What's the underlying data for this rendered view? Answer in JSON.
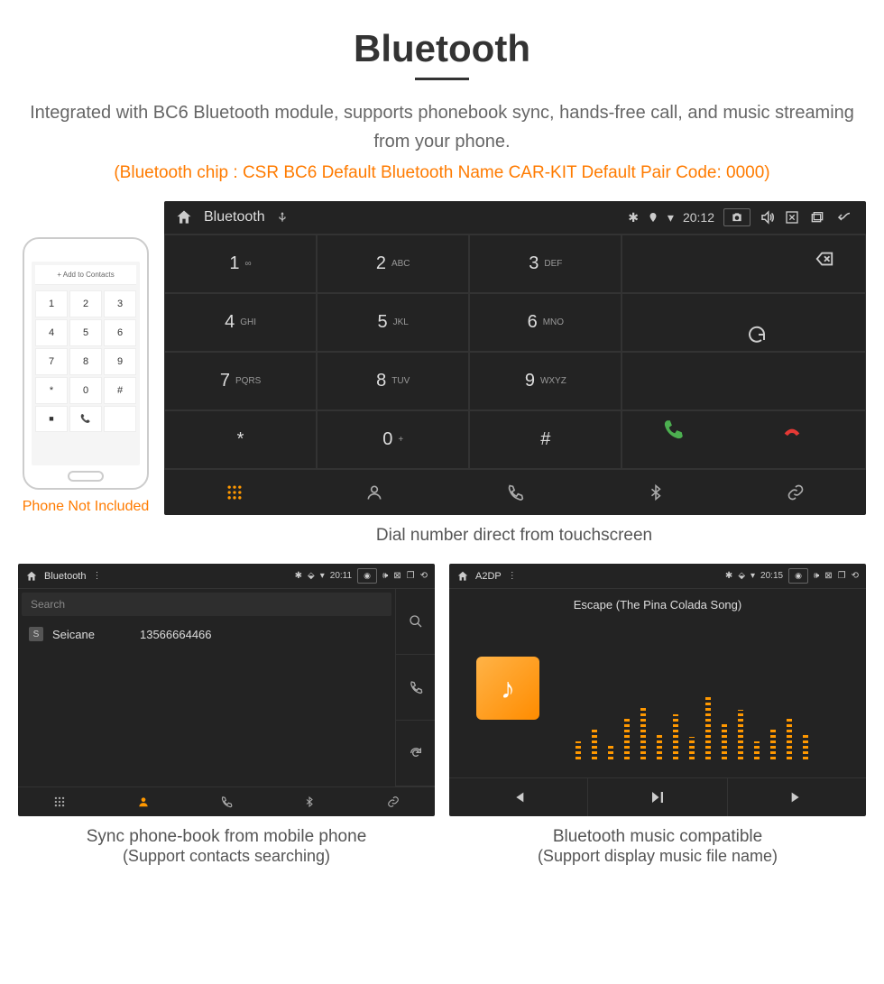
{
  "title": "Bluetooth",
  "description": "Integrated with BC6 Bluetooth module, supports phonebook sync, hands-free call, and music streaming from your phone.",
  "specs": "(Bluetooth chip : CSR BC6    Default Bluetooth Name CAR-KIT    Default Pair Code: 0000)",
  "phone": {
    "contacts_label": "Add to Contacts",
    "keys": [
      "1",
      "2",
      "3",
      "4",
      "5",
      "6",
      "7",
      "8",
      "9",
      "*",
      "0",
      "#"
    ],
    "disclaimer": "Phone Not Included"
  },
  "main_device": {
    "status_label": "Bluetooth",
    "time": "20:12",
    "keypad": [
      {
        "n": "1",
        "s": "∞"
      },
      {
        "n": "2",
        "s": "ABC"
      },
      {
        "n": "3",
        "s": "DEF"
      },
      {
        "n": "4",
        "s": "GHI"
      },
      {
        "n": "5",
        "s": "JKL"
      },
      {
        "n": "6",
        "s": "MNO"
      },
      {
        "n": "7",
        "s": "PQRS"
      },
      {
        "n": "8",
        "s": "TUV"
      },
      {
        "n": "9",
        "s": "WXYZ"
      },
      {
        "n": "*",
        "s": ""
      },
      {
        "n": "0",
        "s": "+"
      },
      {
        "n": "#",
        "s": ""
      }
    ],
    "caption": "Dial number direct from touchscreen"
  },
  "contacts_device": {
    "status_label": "Bluetooth",
    "time": "20:11",
    "search_placeholder": "Search",
    "contact": {
      "badge": "S",
      "name": "Seicane",
      "number": "13566664466"
    },
    "caption1": "Sync phone-book from mobile phone",
    "caption2": "(Support contacts searching)"
  },
  "music_device": {
    "status_label": "A2DP",
    "time": "20:15",
    "track": "Escape (The Pina Colada Song)",
    "caption1": "Bluetooth music compatible",
    "caption2": "(Support display music file name)"
  }
}
